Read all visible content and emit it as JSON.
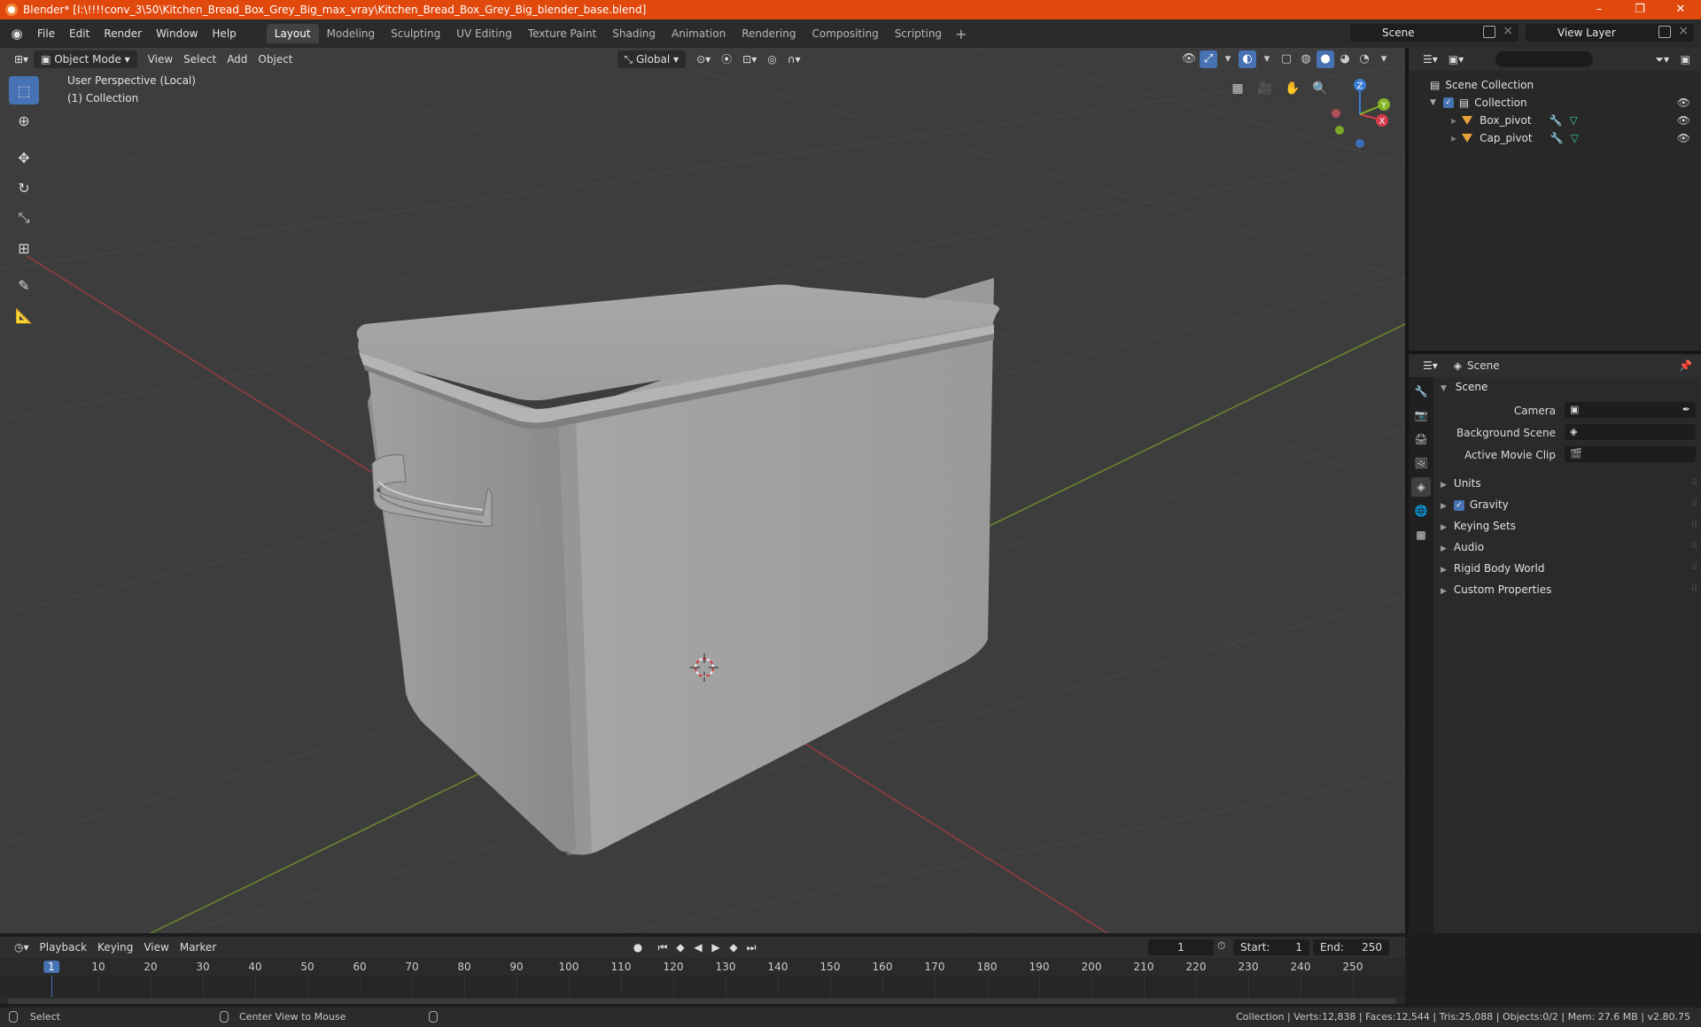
{
  "titlebar": {
    "title": "Blender* [I:\\!!!!conv_3\\50\\Kitchen_Bread_Box_Grey_Big_max_vray\\Kitchen_Bread_Box_Grey_Big_blender_base.blend]",
    "minimize": "–",
    "maximize": "❐",
    "close": "✕"
  },
  "menubar": {
    "menus": [
      "File",
      "Edit",
      "Render",
      "Window",
      "Help"
    ],
    "workspaces": [
      "Layout",
      "Modeling",
      "Sculpting",
      "UV Editing",
      "Texture Paint",
      "Shading",
      "Animation",
      "Rendering",
      "Compositing",
      "Scripting"
    ],
    "active_workspace": "Layout",
    "add_workspace": "+",
    "scene": "Scene",
    "view_layer": "View Layer"
  },
  "viewport": {
    "mode": "Object Mode",
    "menus": [
      "View",
      "Select",
      "Add",
      "Object"
    ],
    "orientation": "Global",
    "info_line1": "User Perspective (Local)",
    "info_line2": "(1) Collection",
    "gizmo": {
      "x": "X",
      "y": "Y",
      "z": "Z"
    }
  },
  "outliner": {
    "root": "Scene Collection",
    "collection": "Collection",
    "objects": [
      "Box_pivot",
      "Cap_pivot"
    ]
  },
  "properties": {
    "header": "Scene",
    "panel": "Scene",
    "camera_label": "Camera",
    "background_scene_label": "Background Scene",
    "active_movie_clip_label": "Active Movie Clip",
    "subpanels": [
      "Units",
      "Gravity",
      "Keying Sets",
      "Audio",
      "Rigid Body World",
      "Custom Properties"
    ],
    "gravity_checked": true
  },
  "timeline": {
    "menus": [
      "Playback",
      "Keying",
      "View",
      "Marker"
    ],
    "current_frame": "1",
    "start_label": "Start:",
    "start": "1",
    "end_label": "End:",
    "end": "250",
    "ruler": [
      "1",
      "10",
      "20",
      "30",
      "40",
      "50",
      "60",
      "70",
      "80",
      "90",
      "100",
      "110",
      "120",
      "130",
      "140",
      "150",
      "160",
      "170",
      "180",
      "190",
      "200",
      "210",
      "220",
      "230",
      "240",
      "250"
    ]
  },
  "statusbar": {
    "left": "Select",
    "middle": "Center View to Mouse",
    "right": "Collection | Verts:12,838 | Faces:12,544 | Tris:25,088 | Objects:0/2 | Mem: 27.6 MB | v2.80.75"
  },
  "colors": {
    "titlebar": "#e0480c",
    "accent": "#4772b3",
    "x_axis": "#d43c4a",
    "y_axis": "#84b324",
    "z_axis": "#3a7cd6"
  }
}
